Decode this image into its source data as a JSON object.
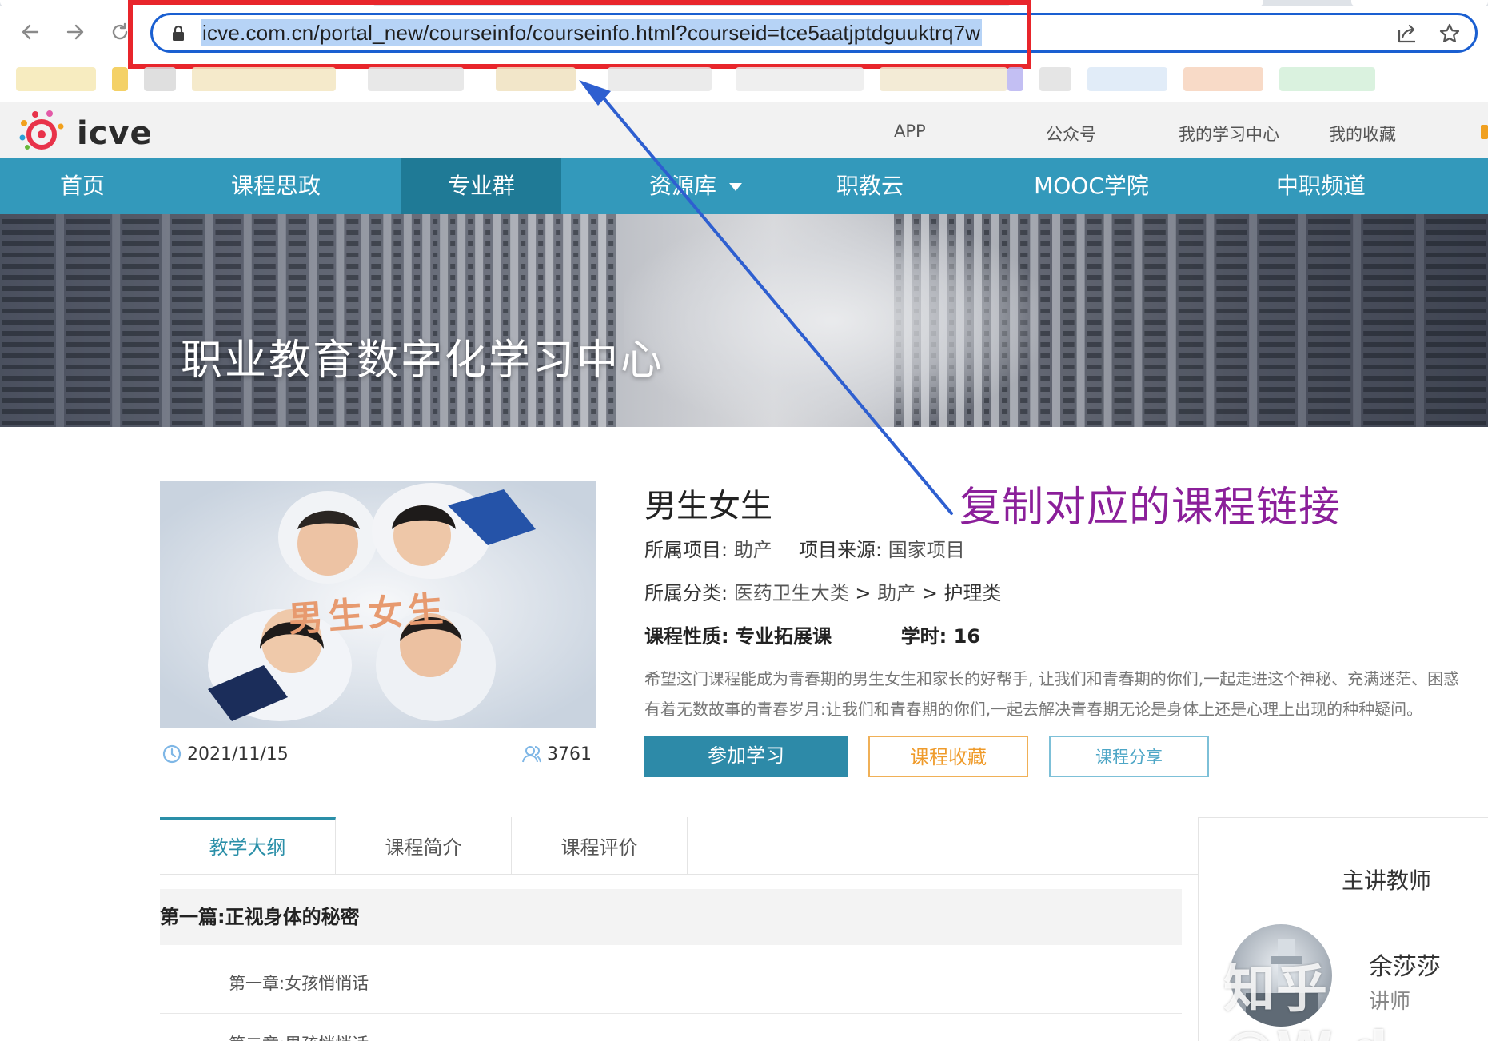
{
  "browser": {
    "url": "icve.com.cn/portal_new/courseinfo/courseinfo.html?courseid=tce5aatjptdguuktrq7w"
  },
  "header": {
    "logo_text": "icve",
    "links": [
      "APP",
      "公众号",
      "我的学习中心",
      "我的收藏"
    ]
  },
  "nav": {
    "items": [
      {
        "label": "首页"
      },
      {
        "label": "课程思政"
      },
      {
        "label": "专业群",
        "active": true
      },
      {
        "label": "资源库",
        "dropdown": true
      },
      {
        "label": "职教云"
      },
      {
        "label": "MOOC学院"
      },
      {
        "label": "中职频道"
      }
    ]
  },
  "banner": {
    "title": "职业教育数字化学习中心"
  },
  "annotation": {
    "text": "复制对应的课程链接",
    "color": "#8b1f9a",
    "highlight_color": "#e8252b",
    "arrow_color": "#2e5fd0"
  },
  "course": {
    "cover_title": "男生女生",
    "date": "2021/11/15",
    "learners": "3761",
    "name": "男生女生",
    "project_label": "所属项目:",
    "project_value": "助产",
    "source_label": "项目来源:",
    "source_value": "国家项目",
    "category_label": "所属分类:",
    "category_path": [
      "医药卫生大类",
      "助产",
      "护理类"
    ],
    "nature_label": "课程性质:",
    "nature_value": "专业拓展课",
    "hours_label": "学时:",
    "hours_value": "16",
    "description_line1": "希望这门课程能成为青春期的男生女生和家长的好帮手, 让我们和青春期的你们,一起走进这个神秘、充满迷茫、困惑",
    "description_line2": "有着无数故事的青春岁月:让我们和青春期的你们,一起去解决青春期无论是身体上还是心理上出现的种种疑问。",
    "buttons": {
      "join": "参加学习",
      "favorite": "课程收藏",
      "share": "课程分享"
    }
  },
  "tabs": [
    {
      "label": "教学大纲",
      "active": true
    },
    {
      "label": "课程简介"
    },
    {
      "label": "课程评价"
    }
  ],
  "syllabus": {
    "section_title": "第一篇:正视身体的秘密",
    "chapters": [
      "第一章:女孩悄悄话",
      "第二章:男孩悄悄话"
    ]
  },
  "teacher": {
    "heading": "主讲教师",
    "name": "余莎莎",
    "role": "讲师"
  },
  "watermark": "知乎 @W.d",
  "colors": {
    "nav_bg": "#3399bb",
    "nav_active": "#1f7a96",
    "accent": "#2d8aa8"
  }
}
